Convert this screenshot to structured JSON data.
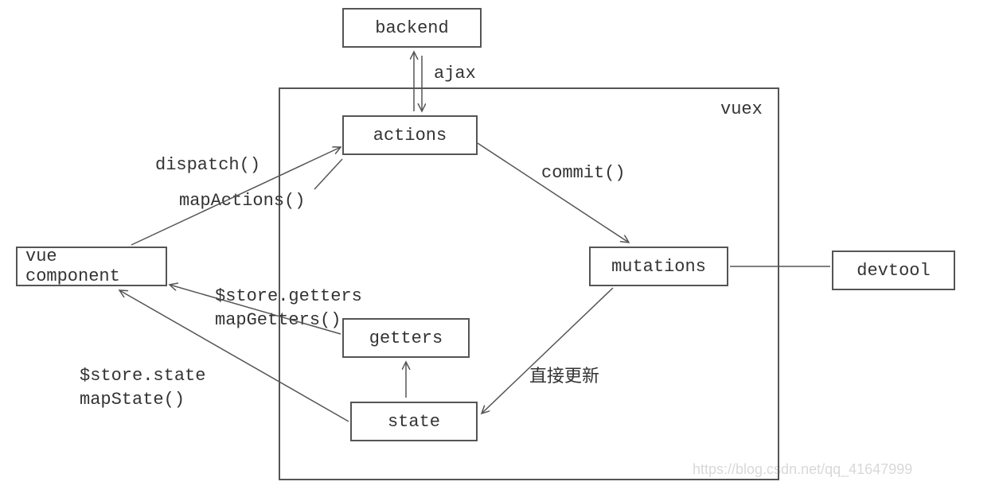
{
  "nodes": {
    "backend": "backend",
    "actions": "actions",
    "mutations": "mutations",
    "getters": "getters",
    "state": "state",
    "vue_component": "vue component",
    "devtool": "devtool"
  },
  "container": {
    "vuex": "vuex"
  },
  "edges": {
    "ajax": "ajax",
    "dispatch": "dispatch()",
    "mapActions": "mapActions()",
    "commit": "commit()",
    "store_getters": "$store.getters",
    "mapGetters": "mapGetters()",
    "store_state": "$store.state",
    "mapState": "mapState()",
    "direct_update": "直接更新"
  },
  "watermark": "https://blog.csdn.net/qq_41647999"
}
